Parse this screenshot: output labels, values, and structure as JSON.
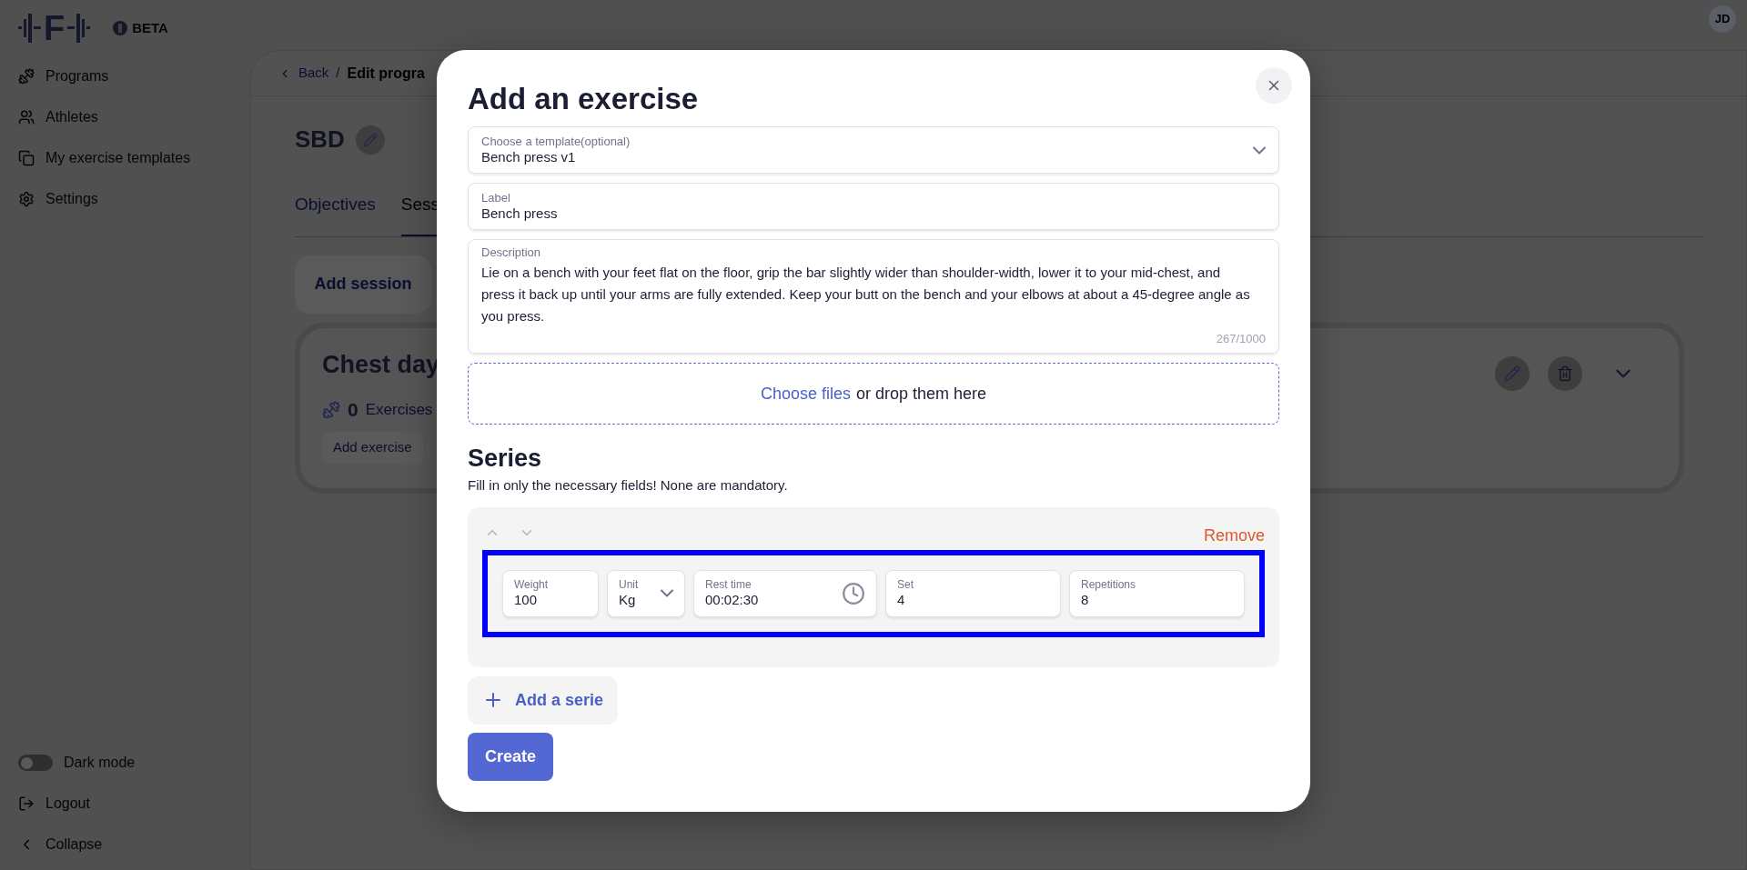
{
  "header": {
    "logo_letter": "F",
    "badge": "BETA",
    "avatar": "JD"
  },
  "sidebar": {
    "items": [
      {
        "label": "Programs"
      },
      {
        "label": "Athletes"
      },
      {
        "label": "My exercise templates"
      },
      {
        "label": "Settings"
      }
    ],
    "dark_mode": {
      "label": "Dark mode",
      "on": false
    },
    "logout": "Logout",
    "collapse": "Collapse"
  },
  "page": {
    "breadcrumb": {
      "back": "Back",
      "separator": "/",
      "current": "Edit progra"
    },
    "title": "SBD",
    "tabs": [
      {
        "label": "Objectives",
        "selected": false
      },
      {
        "label": "Sess",
        "selected": true
      }
    ],
    "add_session": "Add session",
    "session": {
      "title": "Chest day",
      "count": "0",
      "count_label": "Exercises",
      "add_exercise": "Add exercise"
    }
  },
  "modal": {
    "title": "Add an exercise",
    "template": {
      "label": "Choose a template(optional)",
      "value": "Bench press v1"
    },
    "label_field": {
      "label": "Label",
      "value": "Bench press"
    },
    "description": {
      "label": "Description",
      "value": "Lie on a bench with your feet flat on the floor, grip the bar slightly wider than shoulder-width, lower it to your mid-chest, and press it back up until your arms are fully extended. Keep your butt on the bench and your elbows at about a 45-degree angle as you press.",
      "counter": "267/1000"
    },
    "upload": {
      "link": "Choose files",
      "text": "or drop them here"
    },
    "series_title": "Series",
    "series_hint": "Fill in only the necessary fields! None are mandatory.",
    "series": [
      {
        "remove": "Remove",
        "highlighted": true,
        "fields": [
          {
            "kind": "text",
            "label": "Weight",
            "value": "100"
          },
          {
            "kind": "select",
            "label": "Unit",
            "value": "Kg"
          },
          {
            "kind": "time",
            "label": "Rest time",
            "value": "00:02:30"
          },
          {
            "kind": "text",
            "label": "Set",
            "value": "4"
          },
          {
            "kind": "text",
            "label": "Repetitions",
            "value": "8"
          }
        ]
      }
    ],
    "add_serie": "Add a serie",
    "create": "Create"
  }
}
